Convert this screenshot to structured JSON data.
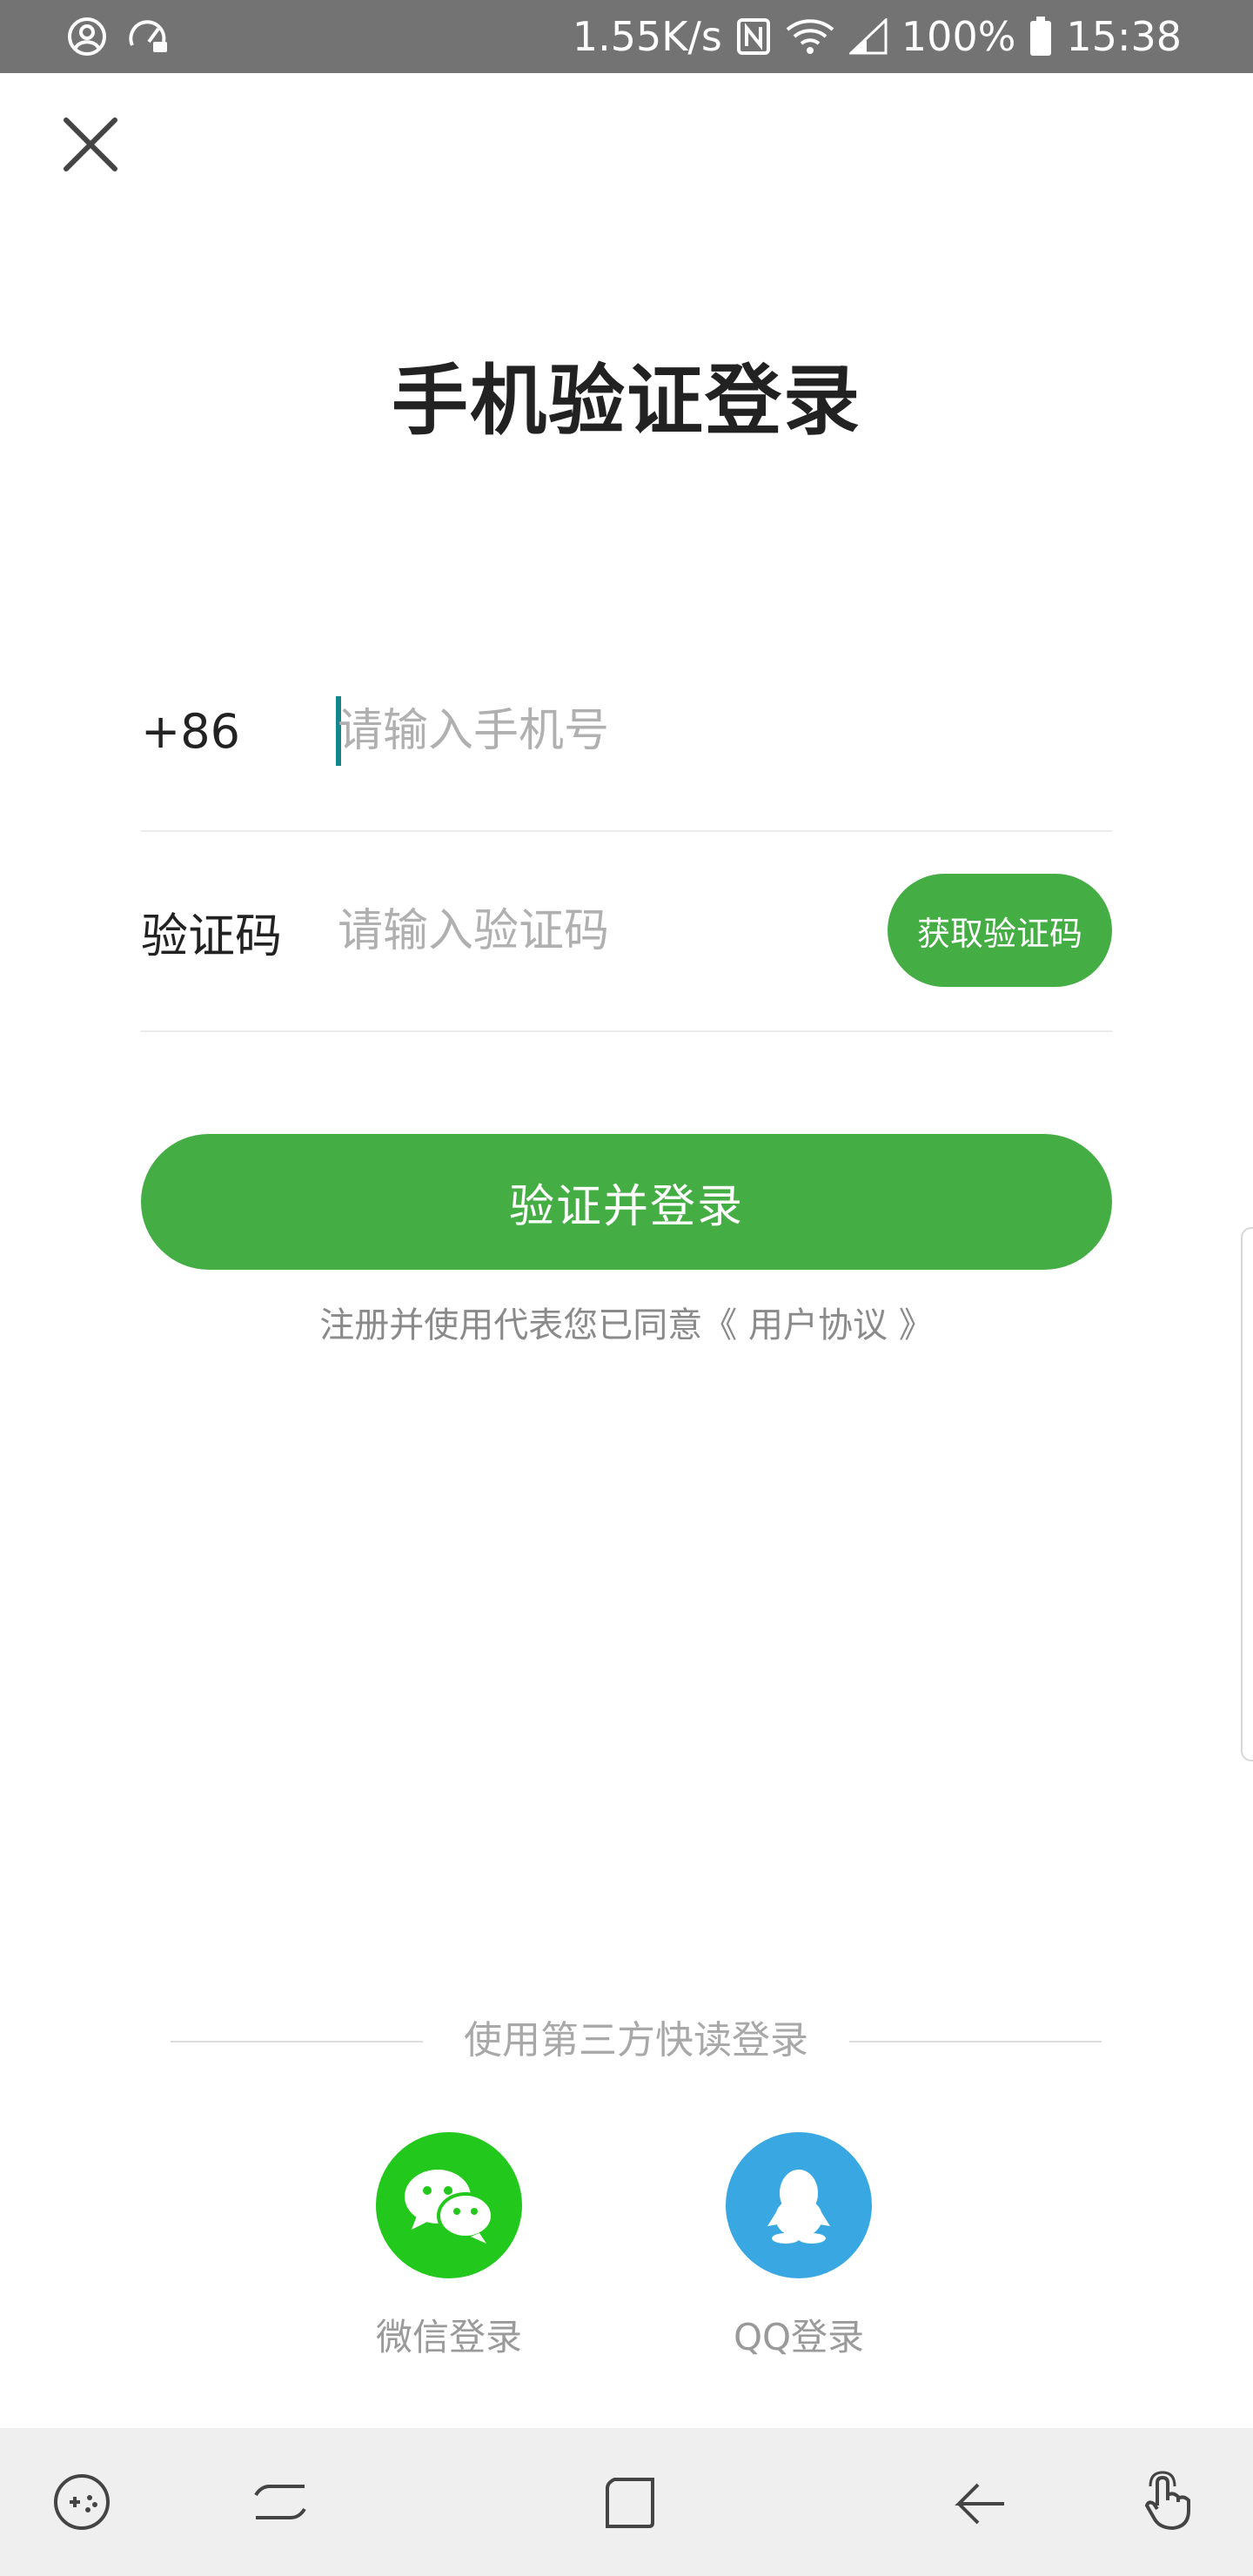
{
  "status_bar": {
    "net_speed": "1.55K/s",
    "battery": "100%",
    "time": "15:38",
    "icons": [
      "account-icon",
      "speedometer-icon",
      "nfc-icon",
      "wifi-icon",
      "signal-icon",
      "battery-icon"
    ]
  },
  "header": {
    "close_icon": "close-icon",
    "title": "手机验证登录"
  },
  "form": {
    "phone": {
      "country_code": "+86",
      "placeholder": "请输入手机号",
      "value": ""
    },
    "code": {
      "label": "验证码",
      "placeholder": "请输入验证码",
      "value": "",
      "get_code_label": "获取验证码"
    },
    "submit_label": "验证并登录",
    "agreement_prefix": "注册并使用代表您已同意",
    "agreement_link": "《 用户协议 》"
  },
  "third_party": {
    "heading": "使用第三方快读登录",
    "options": [
      {
        "label": "微信登录",
        "icon": "wechat-icon",
        "color": "#23c81c"
      },
      {
        "label": "QQ登录",
        "icon": "qq-icon",
        "color": "#39a8e2"
      }
    ]
  },
  "nav_bar": {
    "icons": [
      "game-tools-icon",
      "recents-icon",
      "home-icon",
      "back-icon",
      "touch-gesture-icon"
    ]
  },
  "colors": {
    "accent": "#44ad44",
    "status_bar": "#737373",
    "nav_bar": "#efefef",
    "caret": "#13878a"
  }
}
